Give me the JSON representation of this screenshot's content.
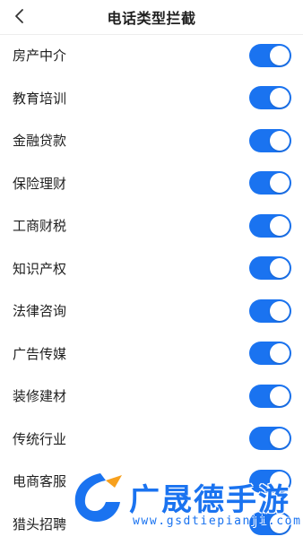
{
  "header": {
    "title": "电话类型拦截",
    "back_icon": "chevron-left-icon"
  },
  "accent_color": "#1a73f0",
  "items": [
    {
      "label": "房产中介",
      "enabled": true
    },
    {
      "label": "教育培训",
      "enabled": true
    },
    {
      "label": "金融贷款",
      "enabled": true
    },
    {
      "label": "保险理财",
      "enabled": true
    },
    {
      "label": "工商财税",
      "enabled": true
    },
    {
      "label": "知识产权",
      "enabled": true
    },
    {
      "label": "法律咨询",
      "enabled": true
    },
    {
      "label": "广告传媒",
      "enabled": true
    },
    {
      "label": "装修建材",
      "enabled": true
    },
    {
      "label": "传统行业",
      "enabled": true
    },
    {
      "label": "电商客服",
      "enabled": true
    },
    {
      "label": "猎头招聘",
      "enabled": true
    }
  ],
  "watermark": {
    "brand": "广晟德手游",
    "url": "www.gsdtiepianji.com"
  }
}
